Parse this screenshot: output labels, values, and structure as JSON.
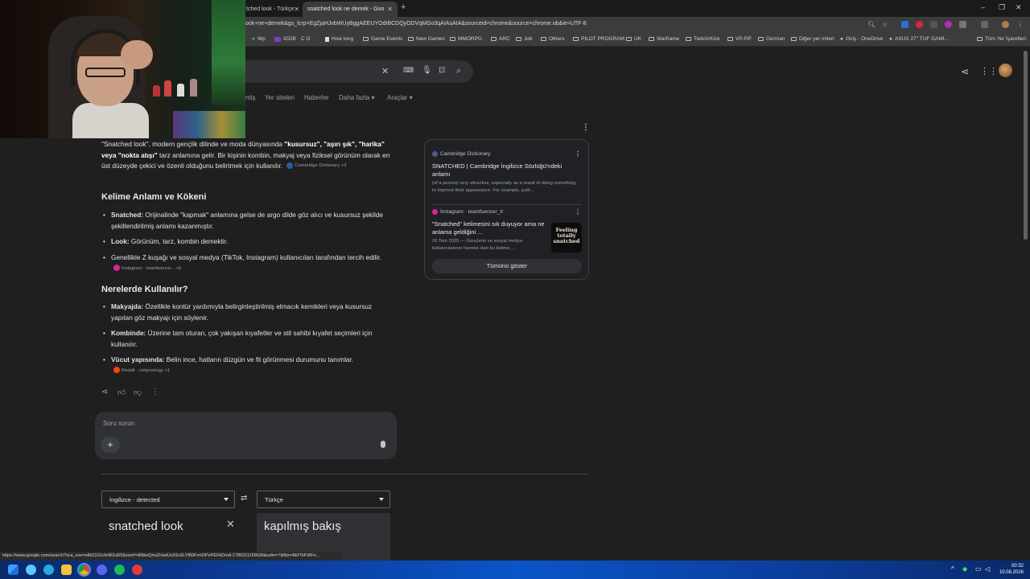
{
  "browser": {
    "tabs": [
      {
        "title": "tched look - Türkçe",
        "active": false
      },
      {
        "title": "snatched look ne demek - Goo",
        "active": true
      }
    ],
    "new_tab": "+",
    "window_controls": [
      "–",
      "❐",
      "✕"
    ],
    "url": "ook+ne+demek&gs_lcrp=EgZjaHJvbWUyBggAEEUYOdIBCDQyODVqMGo3qAIAsAIA&sourceid=chrome&source=chrome.ob&ie=UTF-8",
    "bookmarks": [
      "Wp",
      "IGDB",
      "C O",
      "How long",
      "Game Events",
      "New Games",
      "MMORPG",
      "ARC",
      "Job",
      "Others",
      "PILOT PROGRAM",
      "UK",
      "Warframe",
      "Twitch/Kick",
      "VP-RP",
      "German",
      "Diğer yer imleri",
      "Giriş - OneDrive",
      "ASUS 27\" TUF GAMI...",
      "Tüm Yer İşaretleri"
    ]
  },
  "search": {
    "tabs": [
      "ntiş",
      "Yer siteleri",
      "Haberler",
      "Daha fazla",
      "Araçlar"
    ]
  },
  "answer": {
    "intro_parts": [
      "\"Snatched look\", modern gençlik dilinde ve moda dünyasında ",
      "\"kusursuz\", \"aşırı şık\", \"harika\" veya \"nokta atışı\"",
      " tarz anlamına gelir. Bir kişinin kombin, makyaj veya fiziksel görünüm olarak en üst düzeyde çekici ve özenli olduğunu belirtmek için kullanılır."
    ],
    "intro_chip": "Cambridge Dictionary +3",
    "section1_title": "Kelime Anlamı ve Kökeni",
    "section1_items": [
      {
        "label": "Snatched:",
        "text": " Orijinalinde \"kapmak\" anlamına gelse de argo dilde göz alıcı ve kusursuz şekilde şekillendirilmiş anlamı kazanmıştır.",
        "chip": ""
      },
      {
        "label": "Look:",
        "text": " Görünüm, tarz, kombin demektir.",
        "chip": ""
      },
      {
        "label": "",
        "text": "Genellikle Z kuşağı ve sosyal medya (TikTok, Instagram) kullanıcıları tarafından tercih edilir.",
        "chip": "Instagram · teamfuence... +5"
      }
    ],
    "section2_title": "Nerelerde Kullanılır?",
    "section2_items": [
      {
        "label": "Makyajda:",
        "text": " Özellikle kontür yardımıyla belirginleştirilmiş elmacık kemikleri veya kusursuz yapılan göz makyajı için söylenir.",
        "chip": ""
      },
      {
        "label": "Kombinde:",
        "text": " Üzerine tam oturan, çok yakışan kıyafetler ve stil sahibi kıyafet seçimleri için kullanılır.",
        "chip": ""
      },
      {
        "label": "Vücut yapısında:",
        "text": " Belin ince, hatların düzgün ve fit görünmesi durumunu tanımlar.",
        "chip": "Reddit · r/etymology +1"
      }
    ]
  },
  "ask": {
    "placeholder": "Soru sorun",
    "plus": "+"
  },
  "sources": [
    {
      "site": "Cambridge Dictionary",
      "title": "SNATCHED | Cambridge İngilizce Sözlüğü'ndeki anlamı",
      "snippet": "(of a person) very attractive, especially as a result of doing something to improve their appearance. For example, putti..."
    },
    {
      "site": "Instagram · teamfuencer_tr",
      "title": "\"Snatched\" kelimesini sık duyuyor ama ne anlama geldiğini ...",
      "snippet": "26 Tem 2025 — Gençlerin ve sosyal medya kullanıcılarının favorisi olan bu kelime,..."
    }
  ],
  "thumb_text": "Feeling totally snatched",
  "show_all": "Tümünü göster",
  "translate": {
    "source_lang": "İngilizce - detected",
    "target_lang": "Türkçe",
    "input": "snatched look",
    "output": "kapılmış bakış"
  },
  "status_url": "https://www.google.com/search?sca_esv=e8d1101cfe961a55&sxsrf=ANbeQnuZrwwUc91n2LYf60FrmOPePEFkDmA:1786311159636&udm=7&fbs=AEf7bFWFe...",
  "clock": {
    "time": "00:32",
    "date": "10.08.2026"
  },
  "colors": {
    "background": "#1f1f1f",
    "taskbar": "#0b3fa0",
    "card_border": "#3c4043"
  }
}
